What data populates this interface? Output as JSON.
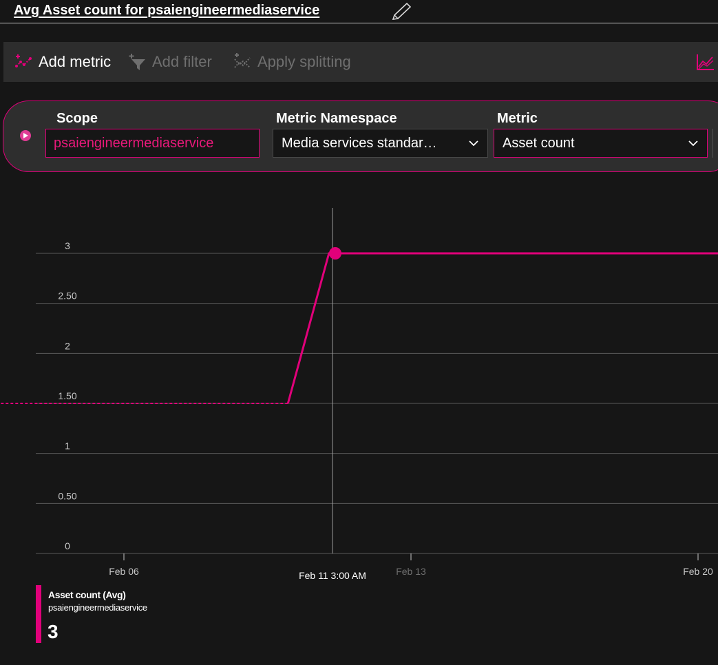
{
  "title": {
    "prefix": "Avg Asset count for ",
    "resource": "psaiengineermediaservice"
  },
  "toolbar": {
    "add_metric": "Add metric",
    "add_filter": "Add filter",
    "apply_splitting": "Apply splitting",
    "icons": [
      "add-metric-icon",
      "add-filter-icon",
      "apply-splitting-icon",
      "chart-type-icon"
    ]
  },
  "scope_row": {
    "scope_label": "Scope",
    "scope_value": "psaiengineermediaservice",
    "namespace_label": "Metric Namespace",
    "namespace_value": "Media services standar…",
    "metric_label": "Metric",
    "metric_value": "Asset count"
  },
  "colors": {
    "accent": "#e1007a",
    "background": "#161616",
    "toolbar": "#2d2d2d",
    "grid": "#5a5a5a"
  },
  "chart_data": {
    "type": "line",
    "series": [
      {
        "name": "Asset count (Avg)",
        "points": [
          {
            "x": "Feb 03",
            "y": 1.5,
            "dashed": true
          },
          {
            "x": "Feb 10",
            "y": 1.5
          },
          {
            "x": "Feb 11",
            "y": 3
          },
          {
            "x": "Feb 21",
            "y": 3
          }
        ]
      }
    ],
    "y_ticks": [
      "0",
      "0.50",
      "1",
      "1.50",
      "2",
      "2.50",
      "3"
    ],
    "ylim": [
      0,
      3
    ],
    "x_ticks": [
      "Feb 06",
      "Feb 13",
      "Feb 20"
    ],
    "cursor_label": "Feb 11 3:00 AM",
    "cursor_value": 3,
    "grid": true
  },
  "legend": {
    "name": "Asset count (Avg)",
    "resource": "psaiengineermediaservice",
    "value": "3"
  }
}
